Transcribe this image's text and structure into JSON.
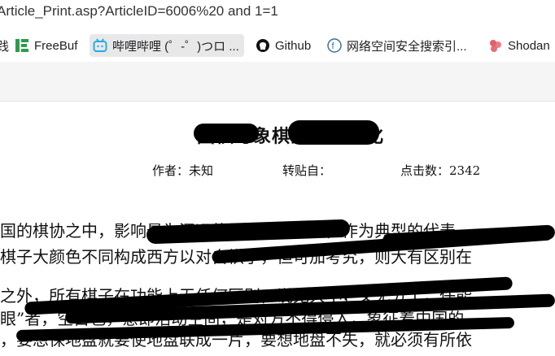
{
  "url": "Article_Print.asp?ArticleID=6006%20 and 1=1",
  "bookmarks": [
    {
      "label": "践",
      "icon": "bookmark-partial-icon",
      "active": false
    },
    {
      "label": "FreeBuf",
      "icon": "freebuf-icon",
      "active": false
    },
    {
      "label": "哔哩哔哩 (゜-゜)つロ ...",
      "icon": "bilibili-icon",
      "active": true
    },
    {
      "label": "Github",
      "icon": "github-icon",
      "active": false
    },
    {
      "label": "网络空间安全搜索引...",
      "icon": "fofa-icon",
      "active": false
    },
    {
      "label": "Shodan",
      "icon": "shodan-icon",
      "active": false
    }
  ],
  "article": {
    "title": "围棋与象棋的传统文化",
    "author_label": "作者：未知",
    "source_label": "转贴自：",
    "clicks_label": "点击数：2342",
    "lines": [
      "国的棋协之中，影响最为深远的是围棋和象棋，作为典型的代表",
      "棋子大颜色不同构成西方以对自棋子，但可加考究，则大有区别在",
      "之外，所有棋子在功能上无任何区别，说无大小，又无分工，任能",
      "眼”者，空目也，意即活动空间，是对方不得侵入，象征着中国的",
      "，要想保地盘就要使地盘联成一片，要想地盘不失，就必须有所依"
    ]
  },
  "colors": {
    "redaction": "#000000",
    "band": "#f5f5f5",
    "active_bookmark": "#e8e8e8"
  }
}
